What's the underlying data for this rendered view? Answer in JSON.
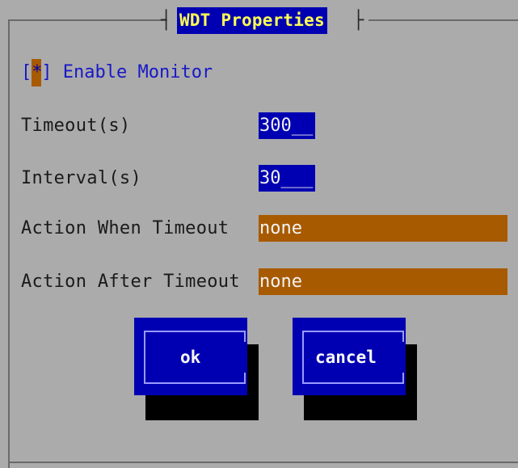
{
  "dialog": {
    "title": "WDT Properties",
    "title_left_bracket": "┤",
    "title_right_bracket": "├"
  },
  "enable_monitor": {
    "open": "[",
    "mark": "*",
    "close": "]",
    "label": "Enable Monitor",
    "checked": true
  },
  "fields": {
    "timeout_label": "Timeout(s)",
    "timeout_value": "300__",
    "interval_label": "Interval(s)",
    "interval_value": "30___",
    "action_when_label": "Action When Timeout",
    "action_when_value": "none",
    "action_after_label": "Action After Timeout",
    "action_after_value": "none"
  },
  "buttons": {
    "ok_label": "ok",
    "cancel_label": "cancel"
  },
  "colors": {
    "background": "#ababab",
    "field_blue": "#0000b2",
    "field_orange": "#a85a00",
    "title_text": "#ffff54",
    "checkbox_text": "#1818c8"
  }
}
